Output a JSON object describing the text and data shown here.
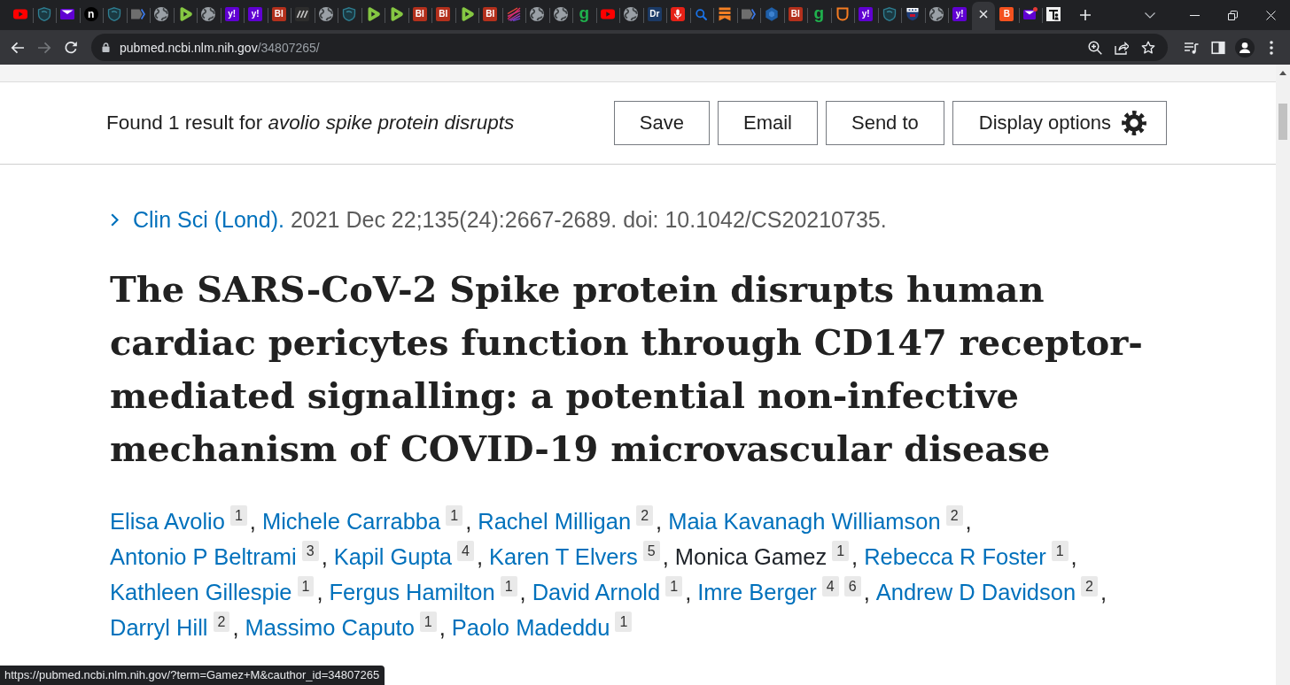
{
  "tabs": [
    {
      "kind": "video",
      "selected": false
    },
    {
      "kind": "shield",
      "selected": false
    },
    {
      "kind": "envelope",
      "selected": false
    },
    {
      "kind": "disc",
      "text": "n",
      "color": "#000000",
      "selected": false
    },
    {
      "kind": "shield",
      "selected": false
    },
    {
      "kind": "chevron",
      "selected": false
    },
    {
      "kind": "globe",
      "selected": false
    },
    {
      "kind": "play",
      "selected": false
    },
    {
      "kind": "globe",
      "selected": false
    },
    {
      "kind": "tile",
      "text": "y!",
      "color": "#6001d2",
      "selected": false
    },
    {
      "kind": "tile",
      "text": "y!",
      "color": "#6001d2",
      "selected": false
    },
    {
      "kind": "tile",
      "text": "BI",
      "color": "#b3301c",
      "selected": false
    },
    {
      "kind": "slashes",
      "selected": false
    },
    {
      "kind": "globe",
      "selected": false
    },
    {
      "kind": "shield",
      "selected": false
    },
    {
      "kind": "play",
      "selected": false
    },
    {
      "kind": "play",
      "selected": false
    },
    {
      "kind": "tile",
      "text": "BI",
      "color": "#b3301c",
      "selected": false
    },
    {
      "kind": "tile",
      "text": "BI",
      "color": "#b3301c",
      "selected": false
    },
    {
      "kind": "play",
      "selected": false
    },
    {
      "kind": "tile",
      "text": "BI",
      "color": "#b3301c",
      "selected": false
    },
    {
      "kind": "starburst",
      "selected": false
    },
    {
      "kind": "globe",
      "selected": false
    },
    {
      "kind": "globe",
      "selected": false
    },
    {
      "kind": "glyph",
      "text": "g",
      "color": "#1fb14d",
      "selected": false
    },
    {
      "kind": "video",
      "selected": false
    },
    {
      "kind": "globe",
      "selected": false
    },
    {
      "kind": "tile",
      "text": "Dr",
      "color": "#1b3a66",
      "selected": false
    },
    {
      "kind": "microphone",
      "selected": false
    },
    {
      "kind": "search",
      "selected": false
    },
    {
      "kind": "bookmark",
      "selected": false
    },
    {
      "kind": "chevron",
      "selected": false
    },
    {
      "kind": "hexagon",
      "selected": false
    },
    {
      "kind": "tile",
      "text": "BI",
      "color": "#b3301c",
      "selected": false
    },
    {
      "kind": "glyph",
      "text": "g",
      "color": "#1fb14d",
      "selected": false
    },
    {
      "kind": "outline",
      "selected": false
    },
    {
      "kind": "tile",
      "text": "y!",
      "color": "#6001d2",
      "selected": false
    },
    {
      "kind": "shield",
      "selected": false
    },
    {
      "kind": "crest",
      "selected": false
    },
    {
      "kind": "globe",
      "selected": false
    },
    {
      "kind": "tile",
      "text": "y!",
      "color": "#6001d2",
      "selected": false
    },
    {
      "selected": true
    },
    {
      "kind": "tile",
      "text": "B",
      "color": "#f4511e",
      "selected": false
    },
    {
      "kind": "envelope-dot",
      "selected": false
    },
    {
      "kind": "figure",
      "selected": false
    }
  ],
  "toolbar": {
    "host": "pubmed.ncbi.nlm.nih.gov",
    "path": "/34807265/",
    "forward_disabled": true
  },
  "results_bar": {
    "summary": "Found 1 result for *avolio spike protein disrupts*",
    "buttons": [
      {
        "label": "Save",
        "kind": "plain"
      },
      {
        "label": "Email",
        "kind": "plain"
      },
      {
        "label": "Send to",
        "kind": "plain"
      },
      {
        "label": "Display options",
        "kind": "settings"
      }
    ]
  },
  "article": {
    "journal": "Clin Sci (Lond).",
    "citation": "2021 Dec 22;135(24):2667-2689. doi: 10.1042/CS20210735.",
    "title": "The SARS-CoV-2 Spike protein disrupts human cardiac pericytes function through CD147 receptor-mediated signalling: a potential non-infective mechanism of COVID-19 microvascular disease",
    "authors": [
      {
        "name": "Elisa Avolio",
        "affiliations": [
          "1"
        ],
        "separator": ",",
        "hovered": false
      },
      {
        "name": "Michele Carrabba",
        "affiliations": [
          "1"
        ],
        "separator": ",",
        "hovered": false
      },
      {
        "name": "Rachel Milligan",
        "affiliations": [
          "2"
        ],
        "separator": ",",
        "hovered": false
      },
      {
        "name": "Maia Kavanagh Williamson",
        "affiliations": [
          "2"
        ],
        "separator": ",",
        "hovered": false
      },
      {
        "name": "Antonio P Beltrami",
        "affiliations": [
          "3"
        ],
        "separator": ",",
        "hovered": false
      },
      {
        "name": "Kapil Gupta",
        "affiliations": [
          "4"
        ],
        "separator": ",",
        "hovered": false
      },
      {
        "name": "Karen T Elvers",
        "affiliations": [
          "5"
        ],
        "separator": ",",
        "hovered": false
      },
      {
        "name": "Monica Gamez",
        "affiliations": [
          "1"
        ],
        "separator": ",",
        "hovered": true
      },
      {
        "name": "Rebecca R Foster",
        "affiliations": [
          "1"
        ],
        "separator": ",",
        "hovered": false
      },
      {
        "name": "Kathleen Gillespie",
        "affiliations": [
          "1"
        ],
        "separator": ",",
        "hovered": false
      },
      {
        "name": "Fergus Hamilton",
        "affiliations": [
          "1"
        ],
        "separator": ",",
        "hovered": false
      },
      {
        "name": "David Arnold",
        "affiliations": [
          "1"
        ],
        "separator": ",",
        "hovered": false
      },
      {
        "name": "Imre Berger",
        "affiliations": [
          "4",
          "6"
        ],
        "separator": ",",
        "hovered": false
      },
      {
        "name": "Andrew D Davidson",
        "affiliations": [
          "2"
        ],
        "separator": ",",
        "hovered": false
      },
      {
        "name": "Darryl Hill",
        "affiliations": [
          "2"
        ],
        "separator": ",",
        "hovered": false
      },
      {
        "name": "Massimo Caputo",
        "affiliations": [
          "1"
        ],
        "separator": ",",
        "hovered": false
      },
      {
        "name": "Paolo Madeddu",
        "affiliations": [
          "1"
        ],
        "hovered": false
      }
    ]
  },
  "status_url": "https://pubmed.ncbi.nlm.nih.gov/?term=Gamez+M&cauthor_id=34807265"
}
